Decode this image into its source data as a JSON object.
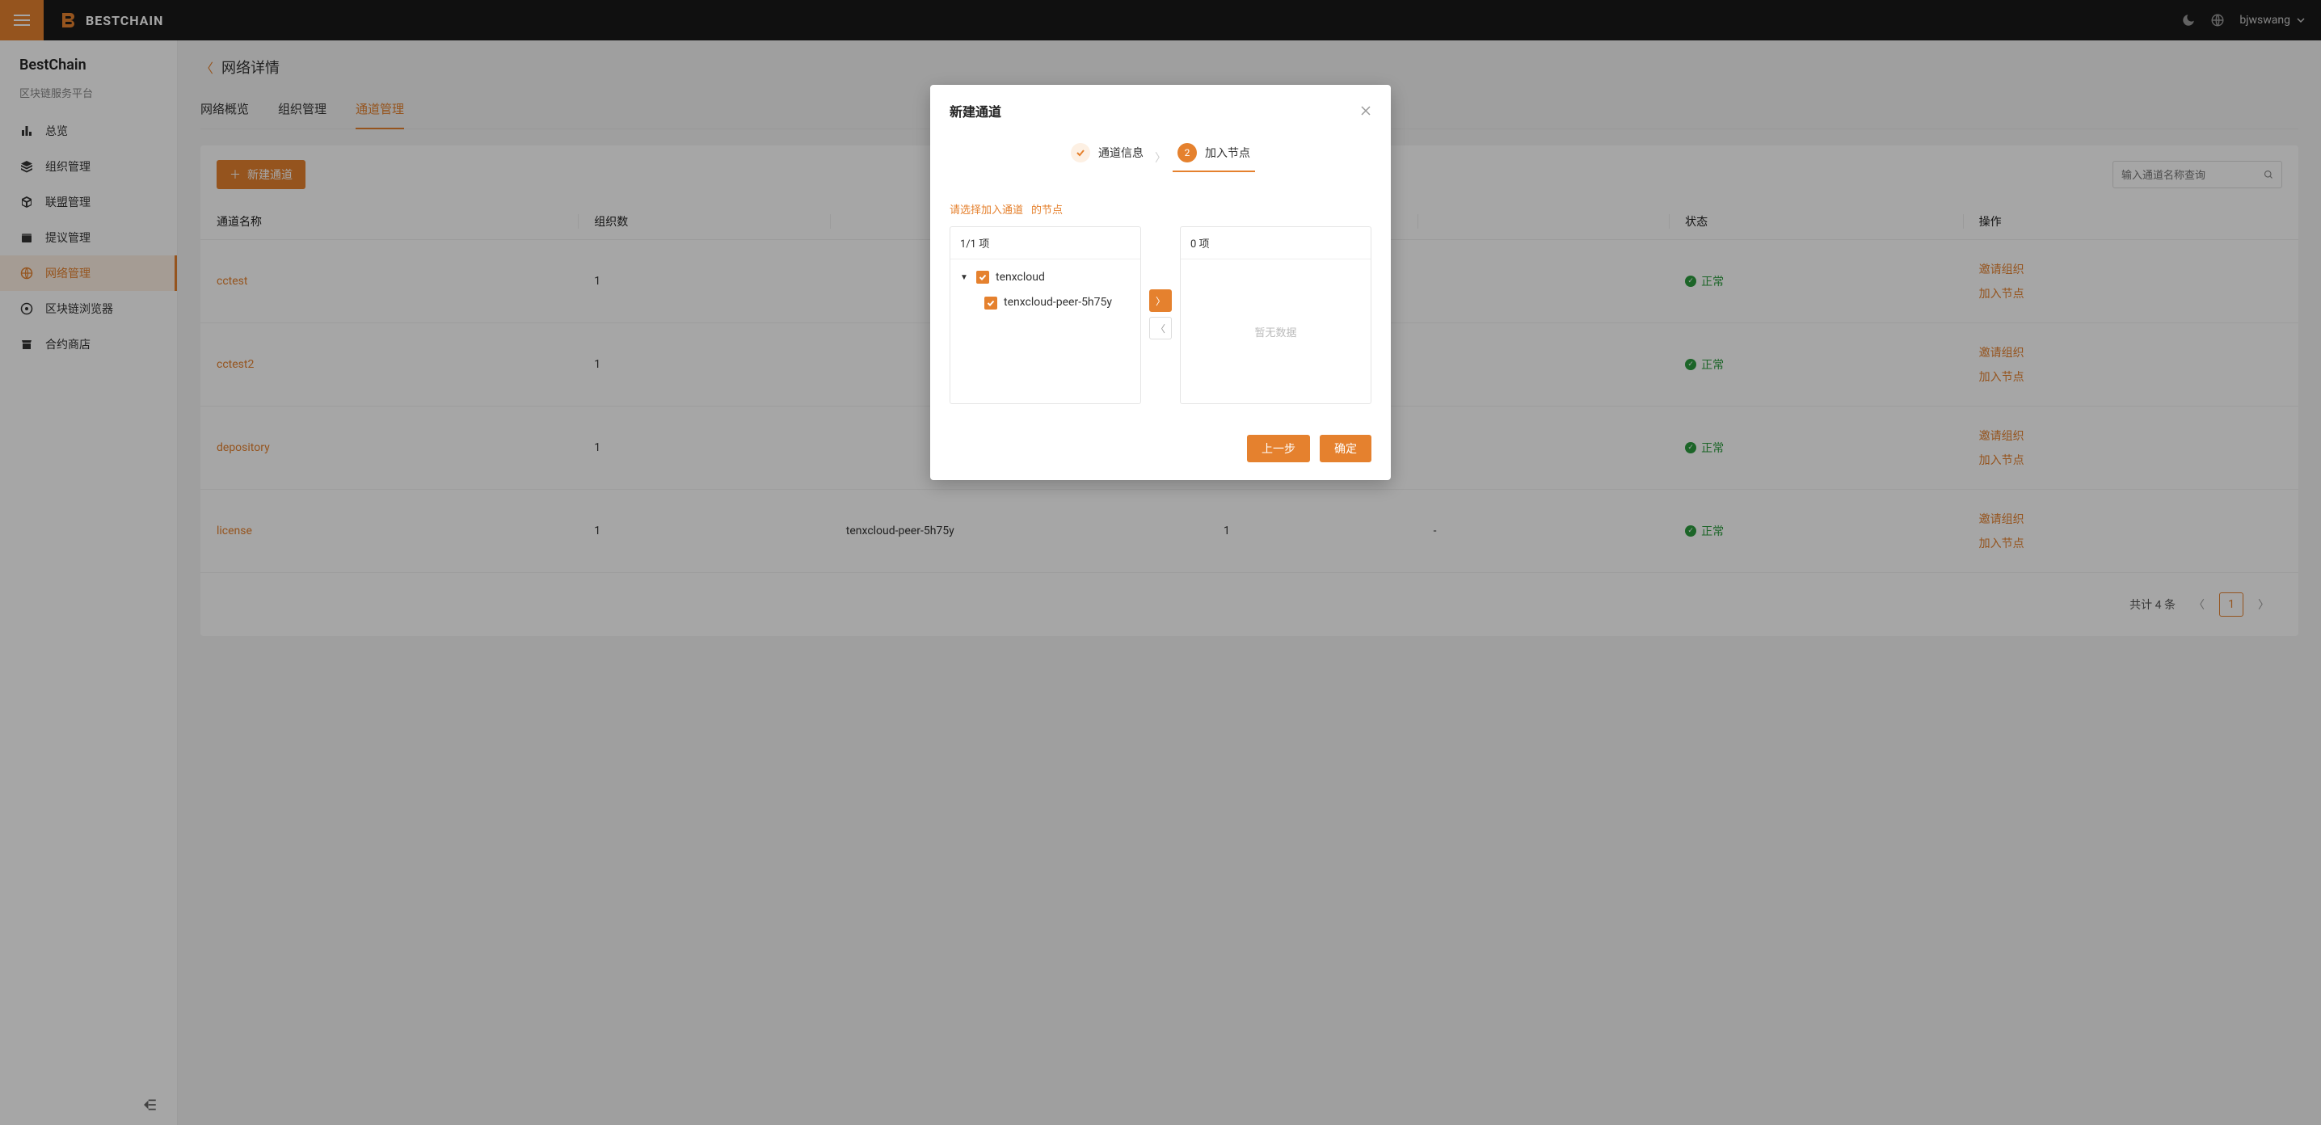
{
  "brand": {
    "name": "BESTCHAIN"
  },
  "user": {
    "name": "bjwswang"
  },
  "sidebar": {
    "title": "BestChain",
    "subtitle": "区块链服务平台",
    "items": [
      {
        "label": "总览",
        "icon": "bar-chart"
      },
      {
        "label": "组织管理",
        "icon": "layers"
      },
      {
        "label": "联盟管理",
        "icon": "cube"
      },
      {
        "label": "提议管理",
        "icon": "calendar"
      },
      {
        "label": "网络管理",
        "icon": "globe",
        "active": true
      },
      {
        "label": "区块链浏览器",
        "icon": "chrome"
      },
      {
        "label": "合约商店",
        "icon": "store"
      }
    ]
  },
  "breadcrumb": {
    "title": "网络详情"
  },
  "tabs": [
    "网络概览",
    "组织管理",
    "通道管理"
  ],
  "active_tab": 2,
  "toolbar": {
    "new_channel_label": "新建通道",
    "search_placeholder": "输入通道名称查询"
  },
  "columns": {
    "name": "通道名称",
    "org_count": "组织数",
    "status": "状态",
    "actions": "操作"
  },
  "status_normal": "正常",
  "actions": {
    "invite": "邀请组织",
    "join": "加入节点"
  },
  "rows": [
    {
      "name": "cctest",
      "org_count": "1",
      "peer": "",
      "peer_count": "",
      "dash": "",
      "status": "正常"
    },
    {
      "name": "cctest2",
      "org_count": "1",
      "peer": "",
      "peer_count": "",
      "dash": "",
      "status": "正常"
    },
    {
      "name": "depository",
      "org_count": "1",
      "peer": "",
      "peer_count": "",
      "dash": "",
      "status": "正常"
    },
    {
      "name": "license",
      "org_count": "1",
      "peer": "tenxcloud-peer-5h75y",
      "peer_count": "1",
      "dash": "-",
      "status": "正常"
    }
  ],
  "pagination": {
    "total_text": "共计 4 条",
    "current": "1"
  },
  "modal": {
    "title": "新建通道",
    "steps": {
      "s1": "通道信息",
      "s2": "加入节点",
      "num2": "2"
    },
    "hint_a": "请选择加入通道",
    "hint_b": "的节点",
    "left_header": "1/1 项",
    "right_header": "0 项",
    "tree_root": "tenxcloud",
    "tree_child": "tenxcloud-peer-5h75y",
    "empty_text": "暂无数据",
    "prev": "上一步",
    "ok": "确定"
  }
}
